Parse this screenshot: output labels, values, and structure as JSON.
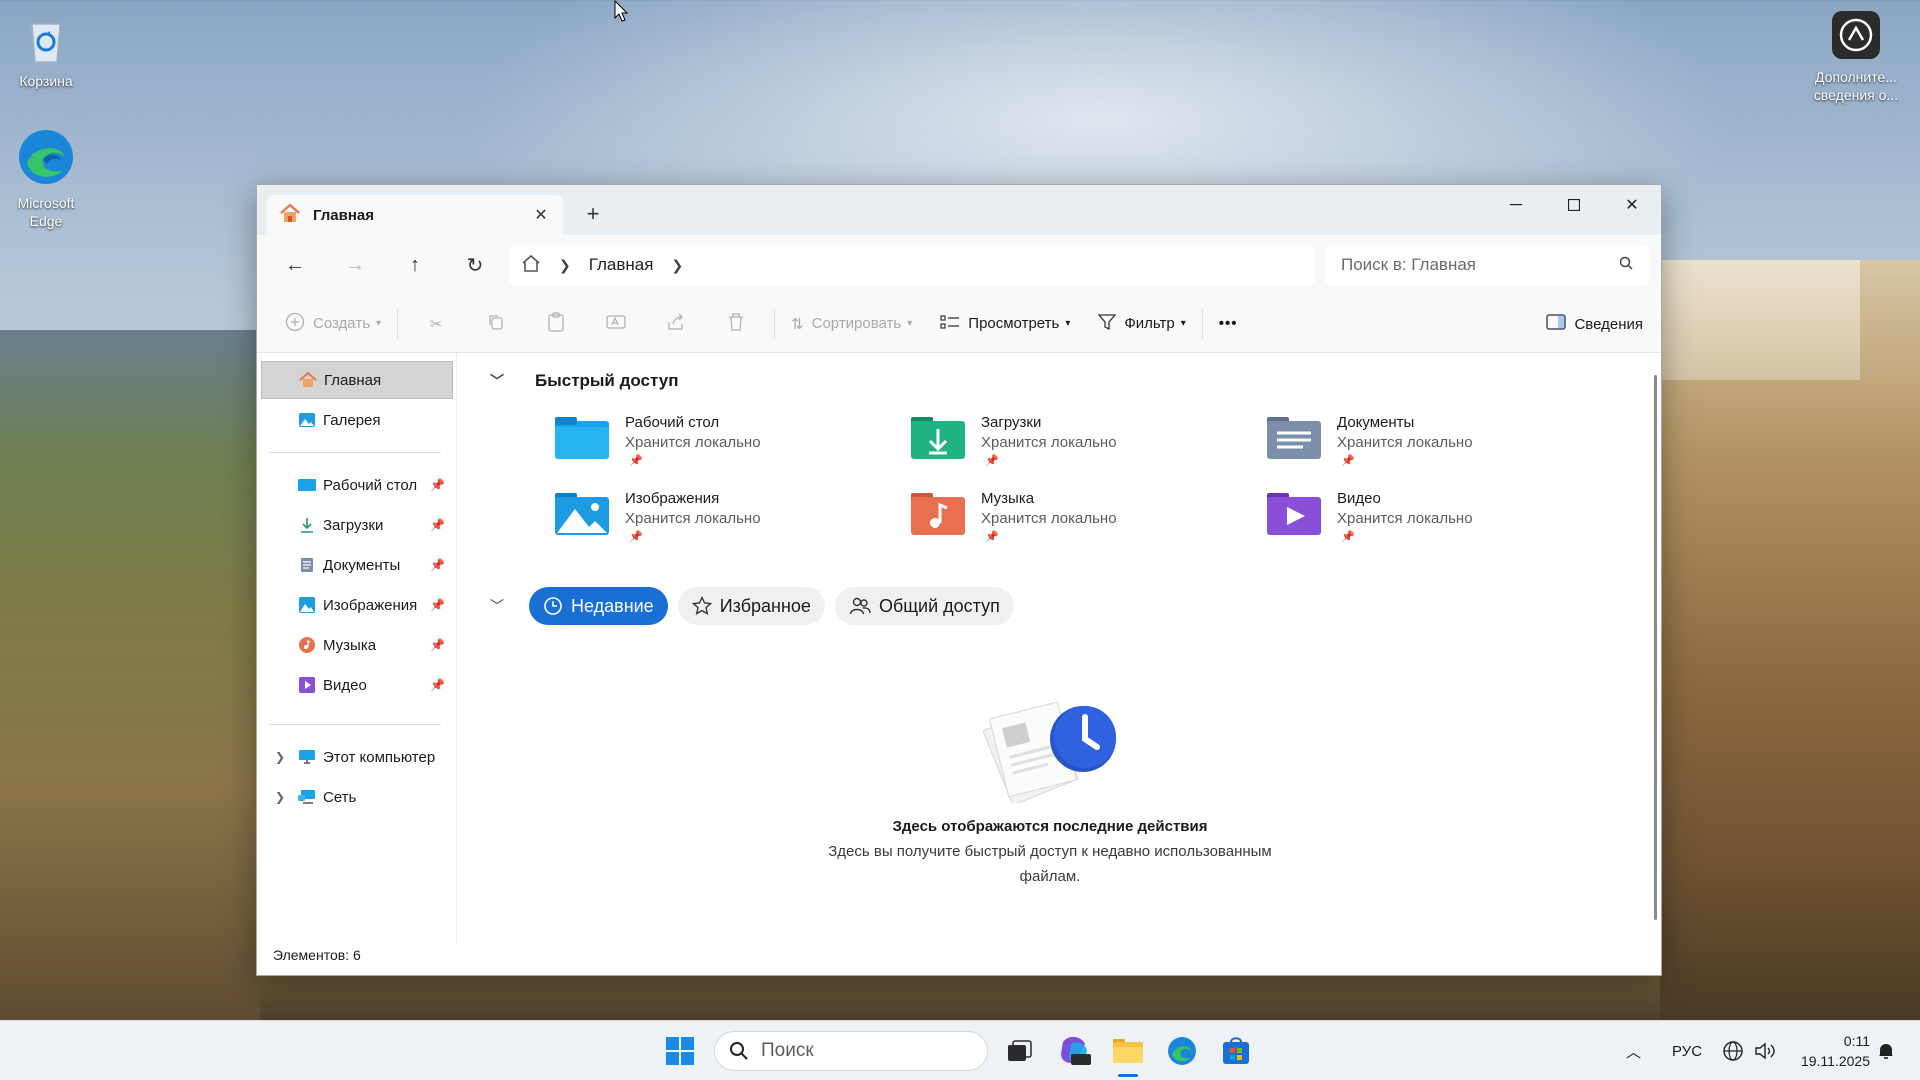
{
  "desktop": {
    "icons": [
      {
        "label": "Корзина"
      },
      {
        "label": "Microsoft Edge"
      },
      {
        "label": "Дополните... сведения о..."
      }
    ]
  },
  "window": {
    "tab_title": "Главная",
    "new_tab": "+",
    "breadcrumb": {
      "current": "Главная"
    },
    "search_placeholder": "Поиск в: Главная",
    "toolbar": {
      "create": "Создать",
      "sort": "Сортировать",
      "view": "Просмотреть",
      "filter": "Фильтр",
      "more": "•••",
      "details": "Сведения"
    },
    "sidebar": {
      "top": [
        {
          "label": "Главная",
          "icon": "home-icon"
        },
        {
          "label": "Галерея",
          "icon": "gallery-icon"
        }
      ],
      "pinned": [
        {
          "label": "Рабочий стол",
          "icon": "desktop-folder-icon"
        },
        {
          "label": "Загрузки",
          "icon": "downloads-icon"
        },
        {
          "label": "Документы",
          "icon": "documents-icon"
        },
        {
          "label": "Изображения",
          "icon": "pictures-icon"
        },
        {
          "label": "Музыка",
          "icon": "music-icon"
        },
        {
          "label": "Видео",
          "icon": "video-icon"
        }
      ],
      "tree": [
        {
          "label": "Этот компьютер",
          "icon": "computer-icon"
        },
        {
          "label": "Сеть",
          "icon": "network-icon"
        }
      ]
    },
    "quick_access": {
      "title": "Быстрый доступ",
      "items": [
        {
          "name": "Рабочий стол",
          "status": "Хранится локально",
          "icon": "desktop-folder-icon",
          "color": "#1aa3e8"
        },
        {
          "name": "Загрузки",
          "status": "Хранится локально",
          "icon": "downloads-folder-icon",
          "color": "#1fb383"
        },
        {
          "name": "Документы",
          "status": "Хранится локально",
          "icon": "documents-folder-icon",
          "color": "#7c8fa8"
        },
        {
          "name": "Изображения",
          "status": "Хранится локально",
          "icon": "pictures-folder-icon",
          "color": "#1d9be3"
        },
        {
          "name": "Музыка",
          "status": "Хранится локально",
          "icon": "music-folder-icon",
          "color": "#e8704e"
        },
        {
          "name": "Видео",
          "status": "Хранится локально",
          "icon": "video-folder-icon",
          "color": "#8a4fd8"
        }
      ]
    },
    "filters": {
      "recent": "Недавние",
      "favorites": "Избранное",
      "shared": "Общий доступ"
    },
    "empty_state": {
      "title": "Здесь отображаются последние действия",
      "text": "Здесь вы получите быстрый доступ к недавно использованным файлам."
    },
    "status": "Элементов: 6"
  },
  "taskbar": {
    "search": "Поиск",
    "language": "РУС",
    "time": "0:11",
    "date": "19.11.2025",
    "apps": [
      "start-icon",
      "task-view-icon",
      "m365-copilot-icon",
      "file-explorer-icon",
      "edge-icon",
      "store-icon"
    ]
  }
}
